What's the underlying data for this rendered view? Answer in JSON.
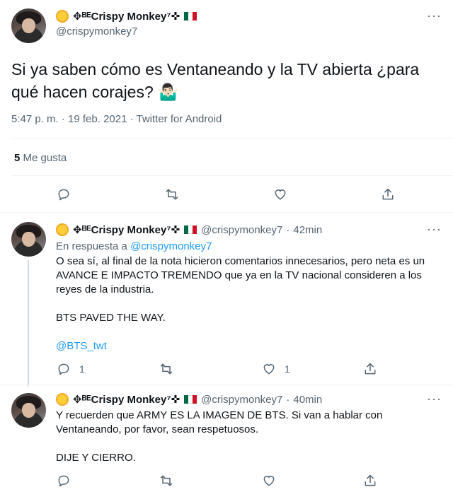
{
  "main_tweet": {
    "author_name": "✥ᴮᴱCrispy Monkey⁷✜",
    "handle": "@crispymonkey7",
    "text": "Si ya saben cómo es Ventaneando y la TV  abierta ¿para qué hacen corajes? 🤷🏻‍♂️",
    "timestamp": "5:47 p. m. · 19 feb. 2021 · Twitter for Android",
    "likes_count": "5",
    "likes_label": "Me gusta",
    "more_label": "···",
    "actions": [
      "reply-icon",
      "retweet-icon",
      "like-icon",
      "share-icon"
    ]
  },
  "replies": [
    {
      "author_name": "✥ᴮᴱCrispy Monkey⁷✜",
      "handle": "@crispymonkey7",
      "separator": "·",
      "time": "42min",
      "reply_to_prefix": "En respuesta a",
      "reply_to_handle": "@crispymonkey7",
      "lines": [
        "O sea sí, al final de la nota hicieron comentarios innecesarios, pero neta es un AVANCE E IMPACTO TREMENDO que ya en la TV nacional consideren a los reyes de la industria.",
        "BTS PAVED THE WAY.",
        "@BTS_twt"
      ],
      "reply_count": "1",
      "retweet_count": "",
      "like_count": "1",
      "more_label": "···"
    },
    {
      "author_name": "✥ᴮᴱCrispy Monkey⁷✜",
      "handle": "@crispymonkey7",
      "separator": "·",
      "time": "40min",
      "lines": [
        "Y recuerden que ARMY ES LA IMAGEN DE BTS. Si van a hablar con Ventaneando, por favor, sean respetuosos.",
        "DIJE Y CIERRO."
      ],
      "more_label": "···"
    }
  ],
  "colors": {
    "text": "#0f1419",
    "muted": "#536471",
    "link": "#1d9bf0",
    "divider": "#eff3f4"
  }
}
